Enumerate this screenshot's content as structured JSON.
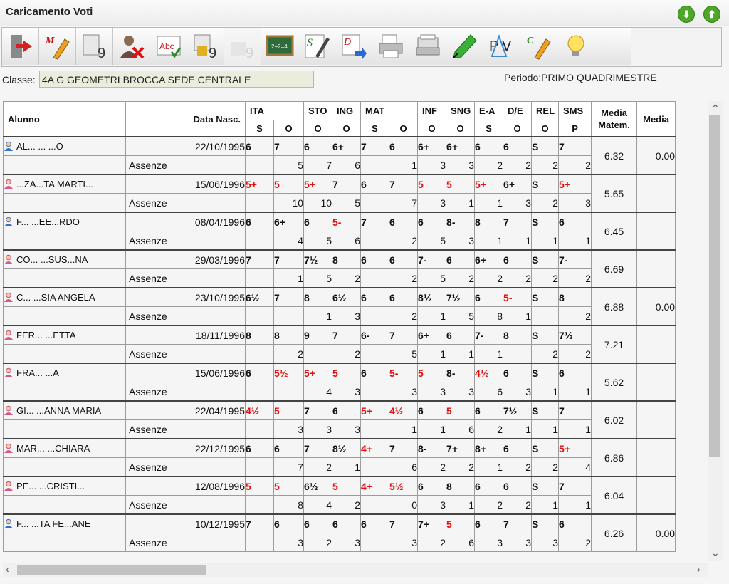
{
  "window": {
    "title": "Caricamento Voti",
    "down_button": "⬇",
    "up_button": "⬆"
  },
  "toolbar": [
    {
      "name": "exit-icon",
      "disabled": false
    },
    {
      "name": "marks-pen-icon",
      "disabled": false
    },
    {
      "name": "grades-calc-icon",
      "disabled": false
    },
    {
      "name": "delete-user-icon",
      "disabled": false
    },
    {
      "name": "spellcheck-icon",
      "disabled": false
    },
    {
      "name": "lock-grades-icon",
      "disabled": false
    },
    {
      "name": "grades-disabled-icon",
      "disabled": true
    },
    {
      "name": "blackboard-icon",
      "disabled": false
    },
    {
      "name": "signature-icon",
      "disabled": false
    },
    {
      "name": "document-export-icon",
      "disabled": false
    },
    {
      "name": "print-icon",
      "disabled": false
    },
    {
      "name": "printer-preview-icon",
      "disabled": false
    },
    {
      "name": "highlighter-icon",
      "disabled": false
    },
    {
      "name": "pv-icon",
      "disabled": false
    },
    {
      "name": "comment-pen-icon",
      "disabled": false
    },
    {
      "name": "lightbulb-icon",
      "disabled": false
    },
    {
      "name": "empty-slot",
      "disabled": false
    }
  ],
  "classe": {
    "label": "Classe:",
    "value": "4A G GEOMETRI BROCCA SEDE CENTRALE"
  },
  "periodo": {
    "text": "Periodo:PRIMO QUADRIMESTRE"
  },
  "header": {
    "alunno": "Alunno",
    "data_nasc": "Data Nasc.",
    "subjects": [
      {
        "name": "ITA",
        "cols": [
          "S",
          "O"
        ]
      },
      {
        "name": "STO",
        "cols": [
          "O"
        ]
      },
      {
        "name": "ING",
        "cols": [
          "O"
        ]
      },
      {
        "name": "MAT",
        "cols": [
          "S",
          "O"
        ]
      },
      {
        "name": "INF",
        "cols": [
          "O"
        ]
      },
      {
        "name": "SNG",
        "cols": [
          "O"
        ]
      },
      {
        "name": "E-A",
        "cols": [
          "S"
        ]
      },
      {
        "name": "D/E",
        "cols": [
          "O"
        ]
      },
      {
        "name": "REL",
        "cols": [
          "O"
        ]
      },
      {
        "name": "SMS",
        "cols": [
          "P"
        ]
      }
    ],
    "media_matem_1": "Media",
    "media_matem_2": "Matem.",
    "media": "Media"
  },
  "assenze_label": "Assenze",
  "students": [
    {
      "name": "AL... ...  ...O",
      "gender": "m",
      "dob": "22/10/1995",
      "grades": [
        {
          "v": "6",
          "red": false
        },
        {
          "v": "7",
          "red": false
        },
        {
          "v": "6",
          "red": false
        },
        {
          "v": "6+",
          "red": false
        },
        {
          "v": "7",
          "red": false
        },
        {
          "v": "6",
          "red": false
        },
        {
          "v": "6+",
          "red": false
        },
        {
          "v": "6+",
          "red": false
        },
        {
          "v": "6",
          "red": false
        },
        {
          "v": "6",
          "red": false
        },
        {
          "v": "S",
          "red": false
        },
        {
          "v": "7",
          "red": false
        }
      ],
      "absences": [
        "",
        "5",
        "7",
        "6",
        "",
        "1",
        "3",
        "3",
        "2",
        "2",
        "2",
        "2"
      ],
      "media_matem": "6.32",
      "media": "0.00"
    },
    {
      "name": "...ZA...TA MARTI...",
      "gender": "f",
      "dob": "15/06/1996",
      "grades": [
        {
          "v": "5+",
          "red": true
        },
        {
          "v": "5",
          "red": true
        },
        {
          "v": "5+",
          "red": true
        },
        {
          "v": "7",
          "red": false
        },
        {
          "v": "6",
          "red": false
        },
        {
          "v": "7",
          "red": false
        },
        {
          "v": "5",
          "red": true
        },
        {
          "v": "5",
          "red": true
        },
        {
          "v": "5+",
          "red": true
        },
        {
          "v": "6+",
          "red": false
        },
        {
          "v": "S",
          "red": false
        },
        {
          "v": "5+",
          "red": true
        }
      ],
      "absences": [
        "",
        "10",
        "10",
        "5",
        "",
        "7",
        "3",
        "1",
        "1",
        "3",
        "2",
        "3"
      ],
      "media_matem": "5.65",
      "media": ""
    },
    {
      "name": "F...  ...EE...RDO",
      "gender": "m",
      "dob": "08/04/1996",
      "grades": [
        {
          "v": "6",
          "red": false
        },
        {
          "v": "6+",
          "red": false
        },
        {
          "v": "6",
          "red": false
        },
        {
          "v": "5-",
          "red": true
        },
        {
          "v": "7",
          "red": false
        },
        {
          "v": "6",
          "red": false
        },
        {
          "v": "6",
          "red": false
        },
        {
          "v": "8-",
          "red": false
        },
        {
          "v": "8",
          "red": false
        },
        {
          "v": "7",
          "red": false
        },
        {
          "v": "S",
          "red": false
        },
        {
          "v": "6",
          "red": false
        }
      ],
      "absences": [
        "",
        "4",
        "5",
        "6",
        "",
        "2",
        "5",
        "3",
        "1",
        "1",
        "1",
        "1"
      ],
      "media_matem": "6.45",
      "media": ""
    },
    {
      "name": "CO... ...SUS...NA",
      "gender": "f",
      "dob": "29/03/1996",
      "grades": [
        {
          "v": "7",
          "red": false
        },
        {
          "v": "7",
          "red": false
        },
        {
          "v": "7½",
          "red": false
        },
        {
          "v": "8",
          "red": false
        },
        {
          "v": "6",
          "red": false
        },
        {
          "v": "6",
          "red": false
        },
        {
          "v": "7-",
          "red": false
        },
        {
          "v": "6",
          "red": false
        },
        {
          "v": "6+",
          "red": false
        },
        {
          "v": "6",
          "red": false
        },
        {
          "v": "S",
          "red": false
        },
        {
          "v": "7-",
          "red": false
        }
      ],
      "absences": [
        "",
        "1",
        "5",
        "2",
        "",
        "2",
        "5",
        "2",
        "2",
        "2",
        "2",
        "2"
      ],
      "media_matem": "6.69",
      "media": ""
    },
    {
      "name": "C... ...SIA ANGELA",
      "gender": "f",
      "dob": "23/10/1995",
      "grades": [
        {
          "v": "6½",
          "red": false
        },
        {
          "v": "7",
          "red": false
        },
        {
          "v": "8",
          "red": false
        },
        {
          "v": "6½",
          "red": false
        },
        {
          "v": "6",
          "red": false
        },
        {
          "v": "6",
          "red": false
        },
        {
          "v": "8½",
          "red": false
        },
        {
          "v": "7½",
          "red": false
        },
        {
          "v": "6",
          "red": false
        },
        {
          "v": "5-",
          "red": true
        },
        {
          "v": "S",
          "red": false
        },
        {
          "v": "8",
          "red": false
        }
      ],
      "absences": [
        "",
        "",
        "1",
        "3",
        "",
        "2",
        "1",
        "5",
        "8",
        "1",
        "",
        "2"
      ],
      "media_matem": "6.88",
      "media": "0.00"
    },
    {
      "name": "FER... ...ETTA",
      "gender": "f",
      "dob": "18/11/1996",
      "grades": [
        {
          "v": "8",
          "red": false
        },
        {
          "v": "8",
          "red": false
        },
        {
          "v": "9",
          "red": false
        },
        {
          "v": "7",
          "red": false
        },
        {
          "v": "6-",
          "red": false
        },
        {
          "v": "7",
          "red": false
        },
        {
          "v": "6+",
          "red": false
        },
        {
          "v": "6",
          "red": false
        },
        {
          "v": "7-",
          "red": false
        },
        {
          "v": "8",
          "red": false
        },
        {
          "v": "S",
          "red": false
        },
        {
          "v": "7½",
          "red": false
        }
      ],
      "absences": [
        "",
        "2",
        "",
        "2",
        "",
        "5",
        "1",
        "1",
        "1",
        "",
        "2",
        "2"
      ],
      "media_matem": "7.21",
      "media": ""
    },
    {
      "name": "FRA... ...A",
      "gender": "f",
      "dob": "15/06/1996",
      "grades": [
        {
          "v": "6",
          "red": false
        },
        {
          "v": "5½",
          "red": true
        },
        {
          "v": "5+",
          "red": true
        },
        {
          "v": "5",
          "red": true
        },
        {
          "v": "6",
          "red": false
        },
        {
          "v": "5-",
          "red": true
        },
        {
          "v": "5",
          "red": true
        },
        {
          "v": "8-",
          "red": false
        },
        {
          "v": "4½",
          "red": true
        },
        {
          "v": "6",
          "red": false
        },
        {
          "v": "S",
          "red": false
        },
        {
          "v": "6",
          "red": false
        }
      ],
      "absences": [
        "",
        "",
        "4",
        "3",
        "",
        "3",
        "3",
        "3",
        "6",
        "3",
        "1",
        "1"
      ],
      "media_matem": "5.62",
      "media": ""
    },
    {
      "name": "GI... ...ANNA MARIA",
      "gender": "f",
      "dob": "22/04/1995",
      "grades": [
        {
          "v": "4½",
          "red": true
        },
        {
          "v": "5",
          "red": true
        },
        {
          "v": "7",
          "red": false
        },
        {
          "v": "6",
          "red": false
        },
        {
          "v": "5+",
          "red": true
        },
        {
          "v": "4½",
          "red": true
        },
        {
          "v": "6",
          "red": false
        },
        {
          "v": "5",
          "red": true
        },
        {
          "v": "6",
          "red": false
        },
        {
          "v": "7½",
          "red": false
        },
        {
          "v": "S",
          "red": false
        },
        {
          "v": "7",
          "red": false
        }
      ],
      "absences": [
        "",
        "3",
        "3",
        "3",
        "",
        "1",
        "1",
        "6",
        "2",
        "1",
        "1",
        "1"
      ],
      "media_matem": "6.02",
      "media": ""
    },
    {
      "name": "MAR... ...CHIARA",
      "gender": "f",
      "dob": "22/12/1995",
      "grades": [
        {
          "v": "6",
          "red": false
        },
        {
          "v": "6",
          "red": false
        },
        {
          "v": "7",
          "red": false
        },
        {
          "v": "8½",
          "red": false
        },
        {
          "v": "4+",
          "red": true
        },
        {
          "v": "7",
          "red": false
        },
        {
          "v": "8-",
          "red": false
        },
        {
          "v": "7+",
          "red": false
        },
        {
          "v": "8+",
          "red": false
        },
        {
          "v": "6",
          "red": false
        },
        {
          "v": "S",
          "red": false
        },
        {
          "v": "5+",
          "red": true
        }
      ],
      "absences": [
        "",
        "7",
        "2",
        "1",
        "",
        "6",
        "2",
        "2",
        "1",
        "2",
        "2",
        "4"
      ],
      "media_matem": "6.86",
      "media": ""
    },
    {
      "name": "PE... ...CRISTI...",
      "gender": "f",
      "dob": "12/08/1996",
      "grades": [
        {
          "v": "5",
          "red": true
        },
        {
          "v": "5",
          "red": true
        },
        {
          "v": "6½",
          "red": false
        },
        {
          "v": "5",
          "red": true
        },
        {
          "v": "4+",
          "red": true
        },
        {
          "v": "5½",
          "red": true
        },
        {
          "v": "6",
          "red": false
        },
        {
          "v": "8",
          "red": false
        },
        {
          "v": "6",
          "red": false
        },
        {
          "v": "6",
          "red": false
        },
        {
          "v": "S",
          "red": false
        },
        {
          "v": "7",
          "red": false
        }
      ],
      "absences": [
        "",
        "8",
        "4",
        "2",
        "",
        "0",
        "3",
        "1",
        "2",
        "2",
        "1",
        "1"
      ],
      "media_matem": "6.04",
      "media": ""
    },
    {
      "name": "F... ...TA FE...ANE",
      "gender": "m",
      "dob": "10/12/1995",
      "grades": [
        {
          "v": "7",
          "red": false
        },
        {
          "v": "6",
          "red": false
        },
        {
          "v": "6",
          "red": false
        },
        {
          "v": "6",
          "red": false
        },
        {
          "v": "6",
          "red": false
        },
        {
          "v": "7",
          "red": false
        },
        {
          "v": "7+",
          "red": false
        },
        {
          "v": "5",
          "red": true
        },
        {
          "v": "6",
          "red": false
        },
        {
          "v": "7",
          "red": false
        },
        {
          "v": "S",
          "red": false
        },
        {
          "v": "6",
          "red": false
        }
      ],
      "absences": [
        "",
        "3",
        "2",
        "3",
        "",
        "3",
        "2",
        "6",
        "3",
        "3",
        "3",
        "2"
      ],
      "media_matem": "6.26",
      "media": "0.00"
    }
  ]
}
